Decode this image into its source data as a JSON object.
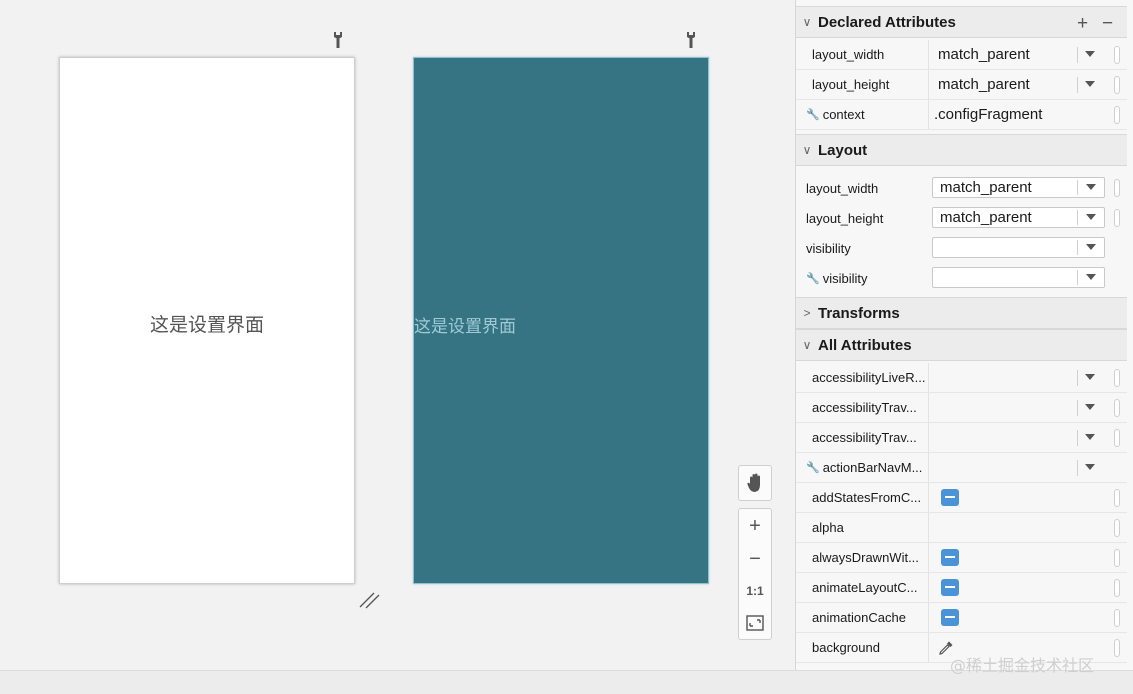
{
  "design": {
    "text": "这是设置界面",
    "blueprint_text": "这是设置界面",
    "blueprint_color": "#367383"
  },
  "zoom": {
    "ratio_label": "1:1",
    "icons": [
      "hand-icon",
      "zoom-in-icon",
      "zoom-out-icon",
      "fit-screen-icon"
    ]
  },
  "panel": {
    "declared": {
      "title": "Declared Attributes",
      "rows": [
        {
          "name": "layout_width",
          "value": "match_parent"
        },
        {
          "name": "layout_height",
          "value": "match_parent"
        },
        {
          "name": "context",
          "value": ".configFragment"
        }
      ]
    },
    "layout": {
      "title": "Layout",
      "rows": [
        {
          "name": "layout_width",
          "value": "match_parent"
        },
        {
          "name": "layout_height",
          "value": "match_parent"
        },
        {
          "name": "visibility",
          "value": ""
        },
        {
          "name": "visibility",
          "value": ""
        }
      ]
    },
    "transforms": {
      "title": "Transforms"
    },
    "all": {
      "title": "All Attributes",
      "rows": [
        {
          "name": "accessibilityLiveR..."
        },
        {
          "name": "accessibilityTrav..."
        },
        {
          "name": "accessibilityTrav..."
        },
        {
          "name": "actionBarNavM..."
        },
        {
          "name": "addStatesFromC..."
        },
        {
          "name": "alpha"
        },
        {
          "name": "alwaysDrawnWit..."
        },
        {
          "name": "animateLayoutC..."
        },
        {
          "name": "animationCache"
        },
        {
          "name": "background"
        }
      ]
    },
    "accent": "#4a93d6"
  },
  "watermark": "@稀土掘金技术社区"
}
